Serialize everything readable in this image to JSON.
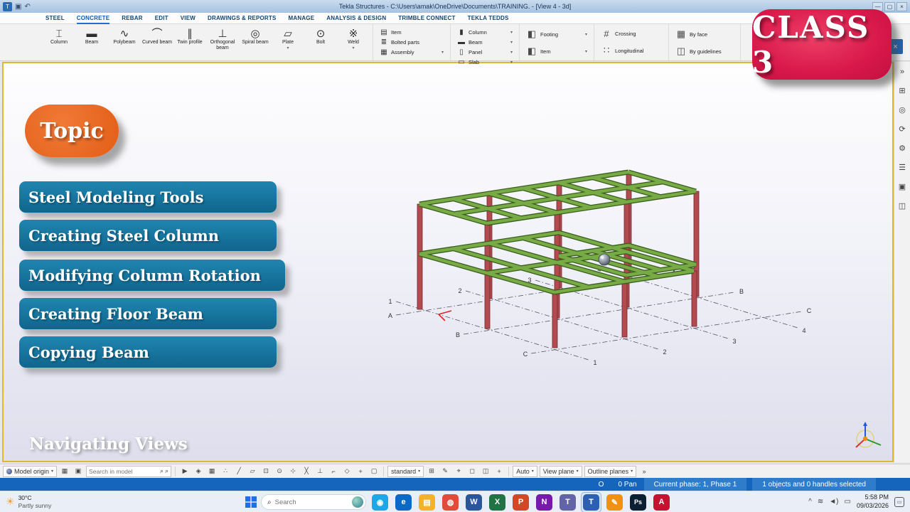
{
  "window": {
    "title": "Tekla Structures - C:\\Users\\amak\\OneDrive\\Documents\\TRAINING. - [View 4 - 3d]"
  },
  "ui": {
    "caret": "▾",
    "menu": "≡",
    "magnifier": "⌕",
    "min": "—",
    "max": "▢",
    "close": "×",
    "pointer": "↖",
    "help": "?",
    "chevrons": "»",
    "save": "▣",
    "undo": "↶"
  },
  "tabs": [
    "STEEL",
    "CONCRETE",
    "REBAR",
    "EDIT",
    "VIEW",
    "DRAWINGS & REPORTS",
    "MANAGE",
    "ANALYSIS & DESIGN",
    "TRIMBLE CONNECT",
    "TEKLA TEDDS"
  ],
  "ribbon": {
    "steel": [
      {
        "label": "Column",
        "icon": "⌶"
      },
      {
        "label": "Beam",
        "icon": "▬"
      },
      {
        "label": "Polybeam",
        "icon": "∿"
      },
      {
        "label": "Curved beam",
        "icon": "⌒"
      },
      {
        "label": "Twin profile",
        "icon": "∥"
      },
      {
        "label": "Orthogonal beam",
        "icon": "⊥"
      },
      {
        "label": "Spiral beam",
        "icon": "◎"
      },
      {
        "label": "Plate",
        "icon": "▱"
      },
      {
        "label": "Bolt",
        "icon": "⊙"
      },
      {
        "label": "Weld",
        "icon": "※"
      }
    ],
    "items": [
      {
        "label": "Item",
        "icon": "▤"
      },
      {
        "label": "Bolted parts",
        "icon": "≣"
      },
      {
        "label": "Assembly",
        "icon": "▦"
      }
    ],
    "concrete": [
      {
        "label": "Column",
        "icon": "▮"
      },
      {
        "label": "Beam",
        "icon": "▬"
      },
      {
        "label": "Panel",
        "icon": "▯"
      },
      {
        "label": "Slab",
        "icon": "▭"
      }
    ],
    "cast": [
      {
        "label": "Footing",
        "icon": "◧"
      },
      {
        "label": "Item",
        "icon": "◧"
      }
    ],
    "rebar": [
      {
        "label": "Crossing",
        "icon": "#"
      },
      {
        "label": "Longitudinal",
        "icon": "∷"
      }
    ],
    "surface": [
      {
        "label": "By face",
        "icon": "▦"
      },
      {
        "label": "By guidelines",
        "icon": "◫"
      }
    ]
  },
  "badge": {
    "text": "CLASS 3"
  },
  "overlay": {
    "topic": "Topic",
    "topics": [
      "Steel Modeling Tools",
      "Creating Steel Column",
      "Modifying Column Rotation",
      "Creating Floor Beam",
      "Copying Beam"
    ],
    "bottom_text": "Navigating Views"
  },
  "viewport": {
    "grid_numbers": [
      "1",
      "2",
      "3",
      "4"
    ],
    "grid_letters": [
      "A",
      "B",
      "C"
    ]
  },
  "toolbar_bottom": {
    "model_origin": "Model origin",
    "search_placeholder": "Search in model",
    "standard": "standard",
    "auto": "Auto",
    "view_plane": "View plane",
    "outline_planes": "Outline planes",
    "snapA": [
      {
        "n": "select-arrow",
        "g": "▶"
      },
      {
        "n": "snap-reference",
        "g": "◈"
      },
      {
        "n": "snap-grid",
        "g": "▦"
      },
      {
        "n": "snap-points",
        "g": "∴"
      },
      {
        "n": "snap-line",
        "g": "╱"
      },
      {
        "n": "snap-plane",
        "g": "▱"
      },
      {
        "n": "snap-end",
        "g": "⊡"
      },
      {
        "n": "snap-center",
        "g": "⊙"
      },
      {
        "n": "snap-midpoint",
        "g": "⊹"
      },
      {
        "n": "snap-intersection",
        "g": "╳"
      },
      {
        "n": "snap-perpendicular",
        "g": "⊥"
      },
      {
        "n": "snap-extension",
        "g": "⌐"
      },
      {
        "n": "snap-nearest",
        "g": "◇"
      },
      {
        "n": "snap-any",
        "g": "+"
      },
      {
        "n": "snap-free",
        "g": "▢"
      }
    ],
    "snapB": [
      {
        "n": "ortho-toggle",
        "g": "⊞"
      },
      {
        "n": "sketch",
        "g": "✎"
      },
      {
        "n": "locate",
        "g": "⌖"
      },
      {
        "n": "clip-plane",
        "g": "◻"
      },
      {
        "n": "view-planes",
        "g": "◫"
      },
      {
        "n": "add-point",
        "g": "+"
      }
    ]
  },
  "statusbar": {
    "snap": "O",
    "pan": "0 Pan",
    "phase": "Current phase: 1, Phase 1",
    "selection": "1 objects and 0 handles selected"
  },
  "right_rail": [
    {
      "n": "panel-collapse",
      "g": "»"
    },
    {
      "n": "pan-tool",
      "g": "⊞"
    },
    {
      "n": "orbit-tool",
      "g": "◎"
    },
    {
      "n": "rotate-view",
      "g": "⟳"
    },
    {
      "n": "settings",
      "g": "⚙"
    },
    {
      "n": "side-pane-list",
      "g": "☰"
    },
    {
      "n": "components",
      "g": "▣"
    },
    {
      "n": "layers",
      "g": "◫"
    }
  ],
  "taskbar": {
    "temp": "30°C",
    "weather": "Partly sunny",
    "search": "Search",
    "time": "5:58 PM",
    "date": "09/03/2026",
    "apps": [
      {
        "name": "copilot",
        "glyph": "◉",
        "color": "#1ea7e8"
      },
      {
        "name": "edge",
        "glyph": "e",
        "color": "#0b69c7"
      },
      {
        "name": "file-explorer",
        "glyph": "▤",
        "color": "#f3b229"
      },
      {
        "name": "chrome",
        "glyph": "◍",
        "color": "#e24b3c"
      },
      {
        "name": "word",
        "glyph": "W",
        "color": "#2b579a"
      },
      {
        "name": "excel",
        "glyph": "X",
        "color": "#217346"
      },
      {
        "name": "powerpoint",
        "glyph": "P",
        "color": "#d24726"
      },
      {
        "name": "onenote",
        "glyph": "N",
        "color": "#7719aa"
      },
      {
        "name": "teams",
        "glyph": "T",
        "color": "#6264a7"
      },
      {
        "name": "tekla",
        "glyph": "T",
        "color": "#2d5fb3"
      },
      {
        "name": "tekla-warehouse",
        "glyph": "✎",
        "color": "#f29111"
      },
      {
        "name": "photoshop",
        "glyph": "Ps",
        "color": "#0b1f33"
      },
      {
        "name": "acrobat",
        "glyph": "A",
        "color": "#c41230"
      }
    ],
    "tray": [
      {
        "n": "tray-chevron-up-icon",
        "g": "^"
      },
      {
        "n": "wifi-icon",
        "g": "≋"
      },
      {
        "n": "speaker-icon",
        "g": "◄)"
      },
      {
        "n": "battery-icon",
        "g": "▭"
      }
    ],
    "notification_glyph": "▭"
  }
}
